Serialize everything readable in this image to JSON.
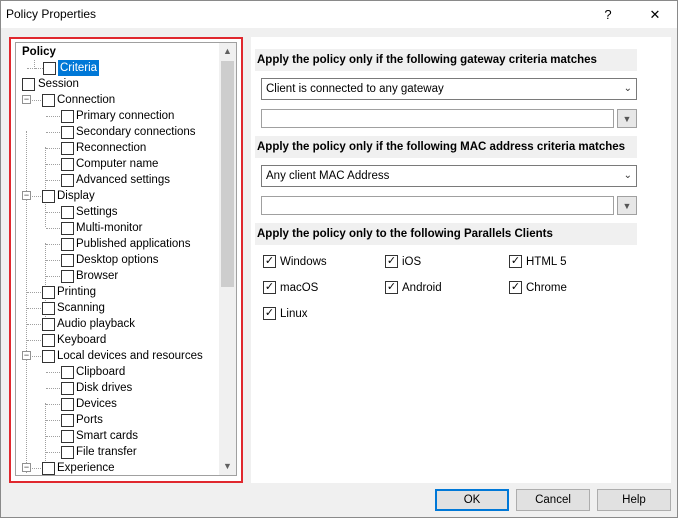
{
  "window": {
    "title": "Policy Properties",
    "help_glyph": "?",
    "close_glyph": "✕"
  },
  "tree": {
    "nodes": [
      {
        "label": "Policy"
      },
      {
        "label": "Criteria"
      },
      {
        "label": "Session"
      },
      {
        "label": "Connection"
      },
      {
        "label": "Primary connection"
      },
      {
        "label": "Secondary connections"
      },
      {
        "label": "Reconnection"
      },
      {
        "label": "Computer name"
      },
      {
        "label": "Advanced settings"
      },
      {
        "label": "Display"
      },
      {
        "label": "Settings"
      },
      {
        "label": "Multi-monitor"
      },
      {
        "label": "Published applications"
      },
      {
        "label": "Desktop options"
      },
      {
        "label": "Browser"
      },
      {
        "label": "Printing"
      },
      {
        "label": "Scanning"
      },
      {
        "label": "Audio playback"
      },
      {
        "label": "Keyboard"
      },
      {
        "label": "Local devices and resources"
      },
      {
        "label": "Clipboard"
      },
      {
        "label": "Disk drives"
      },
      {
        "label": "Devices"
      },
      {
        "label": "Ports"
      },
      {
        "label": "Smart cards"
      },
      {
        "label": "File transfer"
      },
      {
        "label": "Experience"
      }
    ],
    "expander_minus": "−",
    "scroll_up": "▲",
    "scroll_down": "▼"
  },
  "gateway": {
    "heading": "Apply the policy only if the following gateway criteria matches",
    "combo_value": "Client is connected to any gateway",
    "text_value": ""
  },
  "mac": {
    "heading": "Apply the policy only if the following MAC address criteria matches",
    "combo_value": "Any client MAC Address",
    "text_value": ""
  },
  "clients": {
    "heading": "Apply the policy only to the following Parallels Clients",
    "items": [
      {
        "label": "Windows",
        "checked": true
      },
      {
        "label": "iOS",
        "checked": true
      },
      {
        "label": "HTML 5",
        "checked": true
      },
      {
        "label": "macOS",
        "checked": true
      },
      {
        "label": "Android",
        "checked": true
      },
      {
        "label": "Chrome",
        "checked": true
      },
      {
        "label": "Linux",
        "checked": true
      }
    ]
  },
  "buttons": {
    "ok": "OK",
    "cancel": "Cancel",
    "help": "Help"
  },
  "glyphs": {
    "check": "✓",
    "combo_arrow": "⌄",
    "dd_arrow": "▼"
  }
}
